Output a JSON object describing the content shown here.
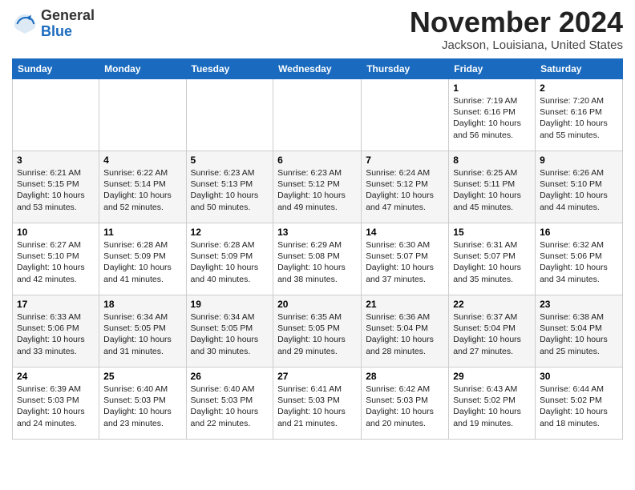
{
  "logo": {
    "general": "General",
    "blue": "Blue"
  },
  "title": "November 2024",
  "location": "Jackson, Louisiana, United States",
  "days_of_week": [
    "Sunday",
    "Monday",
    "Tuesday",
    "Wednesday",
    "Thursday",
    "Friday",
    "Saturday"
  ],
  "weeks": [
    [
      {
        "day": "",
        "info": ""
      },
      {
        "day": "",
        "info": ""
      },
      {
        "day": "",
        "info": ""
      },
      {
        "day": "",
        "info": ""
      },
      {
        "day": "",
        "info": ""
      },
      {
        "day": "1",
        "info": "Sunrise: 7:19 AM\nSunset: 6:16 PM\nDaylight: 10 hours\nand 56 minutes."
      },
      {
        "day": "2",
        "info": "Sunrise: 7:20 AM\nSunset: 6:16 PM\nDaylight: 10 hours\nand 55 minutes."
      }
    ],
    [
      {
        "day": "3",
        "info": "Sunrise: 6:21 AM\nSunset: 5:15 PM\nDaylight: 10 hours\nand 53 minutes."
      },
      {
        "day": "4",
        "info": "Sunrise: 6:22 AM\nSunset: 5:14 PM\nDaylight: 10 hours\nand 52 minutes."
      },
      {
        "day": "5",
        "info": "Sunrise: 6:23 AM\nSunset: 5:13 PM\nDaylight: 10 hours\nand 50 minutes."
      },
      {
        "day": "6",
        "info": "Sunrise: 6:23 AM\nSunset: 5:12 PM\nDaylight: 10 hours\nand 49 minutes."
      },
      {
        "day": "7",
        "info": "Sunrise: 6:24 AM\nSunset: 5:12 PM\nDaylight: 10 hours\nand 47 minutes."
      },
      {
        "day": "8",
        "info": "Sunrise: 6:25 AM\nSunset: 5:11 PM\nDaylight: 10 hours\nand 45 minutes."
      },
      {
        "day": "9",
        "info": "Sunrise: 6:26 AM\nSunset: 5:10 PM\nDaylight: 10 hours\nand 44 minutes."
      }
    ],
    [
      {
        "day": "10",
        "info": "Sunrise: 6:27 AM\nSunset: 5:10 PM\nDaylight: 10 hours\nand 42 minutes."
      },
      {
        "day": "11",
        "info": "Sunrise: 6:28 AM\nSunset: 5:09 PM\nDaylight: 10 hours\nand 41 minutes."
      },
      {
        "day": "12",
        "info": "Sunrise: 6:28 AM\nSunset: 5:09 PM\nDaylight: 10 hours\nand 40 minutes."
      },
      {
        "day": "13",
        "info": "Sunrise: 6:29 AM\nSunset: 5:08 PM\nDaylight: 10 hours\nand 38 minutes."
      },
      {
        "day": "14",
        "info": "Sunrise: 6:30 AM\nSunset: 5:07 PM\nDaylight: 10 hours\nand 37 minutes."
      },
      {
        "day": "15",
        "info": "Sunrise: 6:31 AM\nSunset: 5:07 PM\nDaylight: 10 hours\nand 35 minutes."
      },
      {
        "day": "16",
        "info": "Sunrise: 6:32 AM\nSunset: 5:06 PM\nDaylight: 10 hours\nand 34 minutes."
      }
    ],
    [
      {
        "day": "17",
        "info": "Sunrise: 6:33 AM\nSunset: 5:06 PM\nDaylight: 10 hours\nand 33 minutes."
      },
      {
        "day": "18",
        "info": "Sunrise: 6:34 AM\nSunset: 5:05 PM\nDaylight: 10 hours\nand 31 minutes."
      },
      {
        "day": "19",
        "info": "Sunrise: 6:34 AM\nSunset: 5:05 PM\nDaylight: 10 hours\nand 30 minutes."
      },
      {
        "day": "20",
        "info": "Sunrise: 6:35 AM\nSunset: 5:05 PM\nDaylight: 10 hours\nand 29 minutes."
      },
      {
        "day": "21",
        "info": "Sunrise: 6:36 AM\nSunset: 5:04 PM\nDaylight: 10 hours\nand 28 minutes."
      },
      {
        "day": "22",
        "info": "Sunrise: 6:37 AM\nSunset: 5:04 PM\nDaylight: 10 hours\nand 27 minutes."
      },
      {
        "day": "23",
        "info": "Sunrise: 6:38 AM\nSunset: 5:04 PM\nDaylight: 10 hours\nand 25 minutes."
      }
    ],
    [
      {
        "day": "24",
        "info": "Sunrise: 6:39 AM\nSunset: 5:03 PM\nDaylight: 10 hours\nand 24 minutes."
      },
      {
        "day": "25",
        "info": "Sunrise: 6:40 AM\nSunset: 5:03 PM\nDaylight: 10 hours\nand 23 minutes."
      },
      {
        "day": "26",
        "info": "Sunrise: 6:40 AM\nSunset: 5:03 PM\nDaylight: 10 hours\nand 22 minutes."
      },
      {
        "day": "27",
        "info": "Sunrise: 6:41 AM\nSunset: 5:03 PM\nDaylight: 10 hours\nand 21 minutes."
      },
      {
        "day": "28",
        "info": "Sunrise: 6:42 AM\nSunset: 5:03 PM\nDaylight: 10 hours\nand 20 minutes."
      },
      {
        "day": "29",
        "info": "Sunrise: 6:43 AM\nSunset: 5:02 PM\nDaylight: 10 hours\nand 19 minutes."
      },
      {
        "day": "30",
        "info": "Sunrise: 6:44 AM\nSunset: 5:02 PM\nDaylight: 10 hours\nand 18 minutes."
      }
    ]
  ]
}
